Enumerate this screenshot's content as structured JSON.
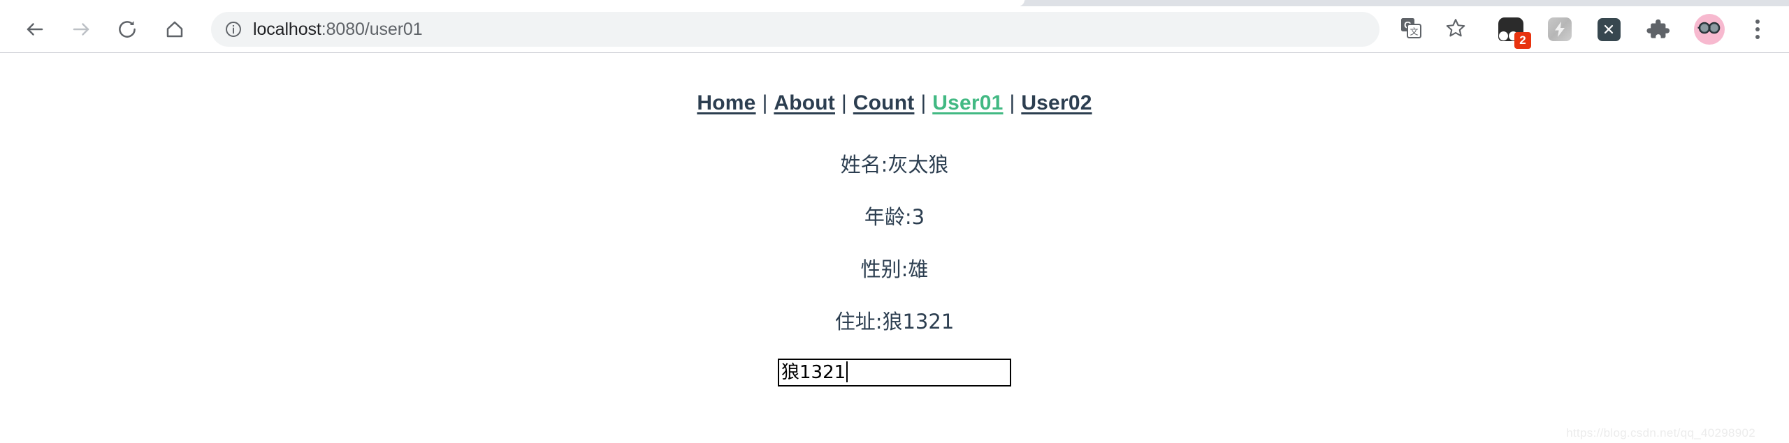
{
  "browser": {
    "back_label": "Back",
    "forward_label": "Forward",
    "reload_label": "Reload",
    "home_label": "Home",
    "url_host": "localhost",
    "url_path": ":8080/user01",
    "url_full": "localhost:8080/user01",
    "site_info_icon": "info-circle-icon",
    "translate_icon": "google-translate-icon",
    "bookmark_icon": "star-outline-icon",
    "extensions": [
      {
        "name": "extension-dark-badge",
        "badge": "2"
      },
      {
        "name": "extension-lightning",
        "badge": ""
      },
      {
        "name": "extension-x",
        "label": "X"
      }
    ],
    "puzzle_icon": "puzzle-piece-icon",
    "avatar_icon": "sunglasses-avatar-icon",
    "menu_icon": "three-dot-menu-icon"
  },
  "site_nav": {
    "links": [
      {
        "label": "Home",
        "active": false
      },
      {
        "label": "About",
        "active": false
      },
      {
        "label": "Count",
        "active": false
      },
      {
        "label": "User01",
        "active": true
      },
      {
        "label": "User02",
        "active": false
      }
    ],
    "separator": "|",
    "active_color": "#42b983",
    "link_color": "#2c3e50"
  },
  "user_info": {
    "name_line": "姓名:灰太狼",
    "age_line": "年龄:3",
    "gender_line": "性别:雄",
    "address_line": "住址:狼1321"
  },
  "address_input": {
    "value": "狼1321",
    "placeholder": ""
  },
  "watermark": {
    "text": "https://blog.csdn.net/qq_40298902"
  }
}
